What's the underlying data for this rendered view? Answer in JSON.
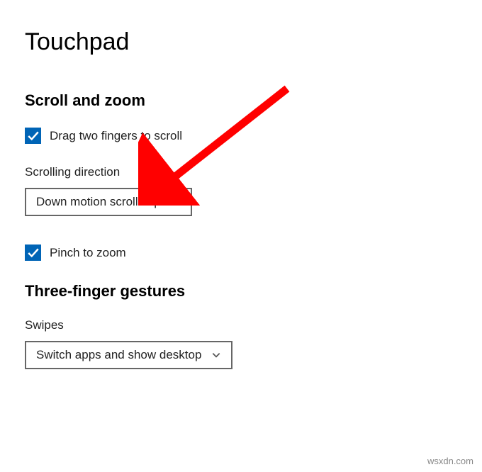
{
  "page": {
    "title": "Touchpad"
  },
  "scroll_zoom": {
    "heading": "Scroll and zoom",
    "drag_two_fingers": {
      "label": "Drag two fingers to scroll",
      "checked": true
    },
    "scrolling_direction": {
      "label": "Scrolling direction",
      "value": "Down motion scrolls up"
    },
    "pinch_zoom": {
      "label": "Pinch to zoom",
      "checked": true
    }
  },
  "three_finger": {
    "heading": "Three-finger gestures",
    "swipes": {
      "label": "Swipes",
      "value": "Switch apps and show desktop"
    }
  },
  "watermark": "wsxdn.com",
  "colors": {
    "accent": "#0064b6",
    "arrow": "#ff0000"
  }
}
